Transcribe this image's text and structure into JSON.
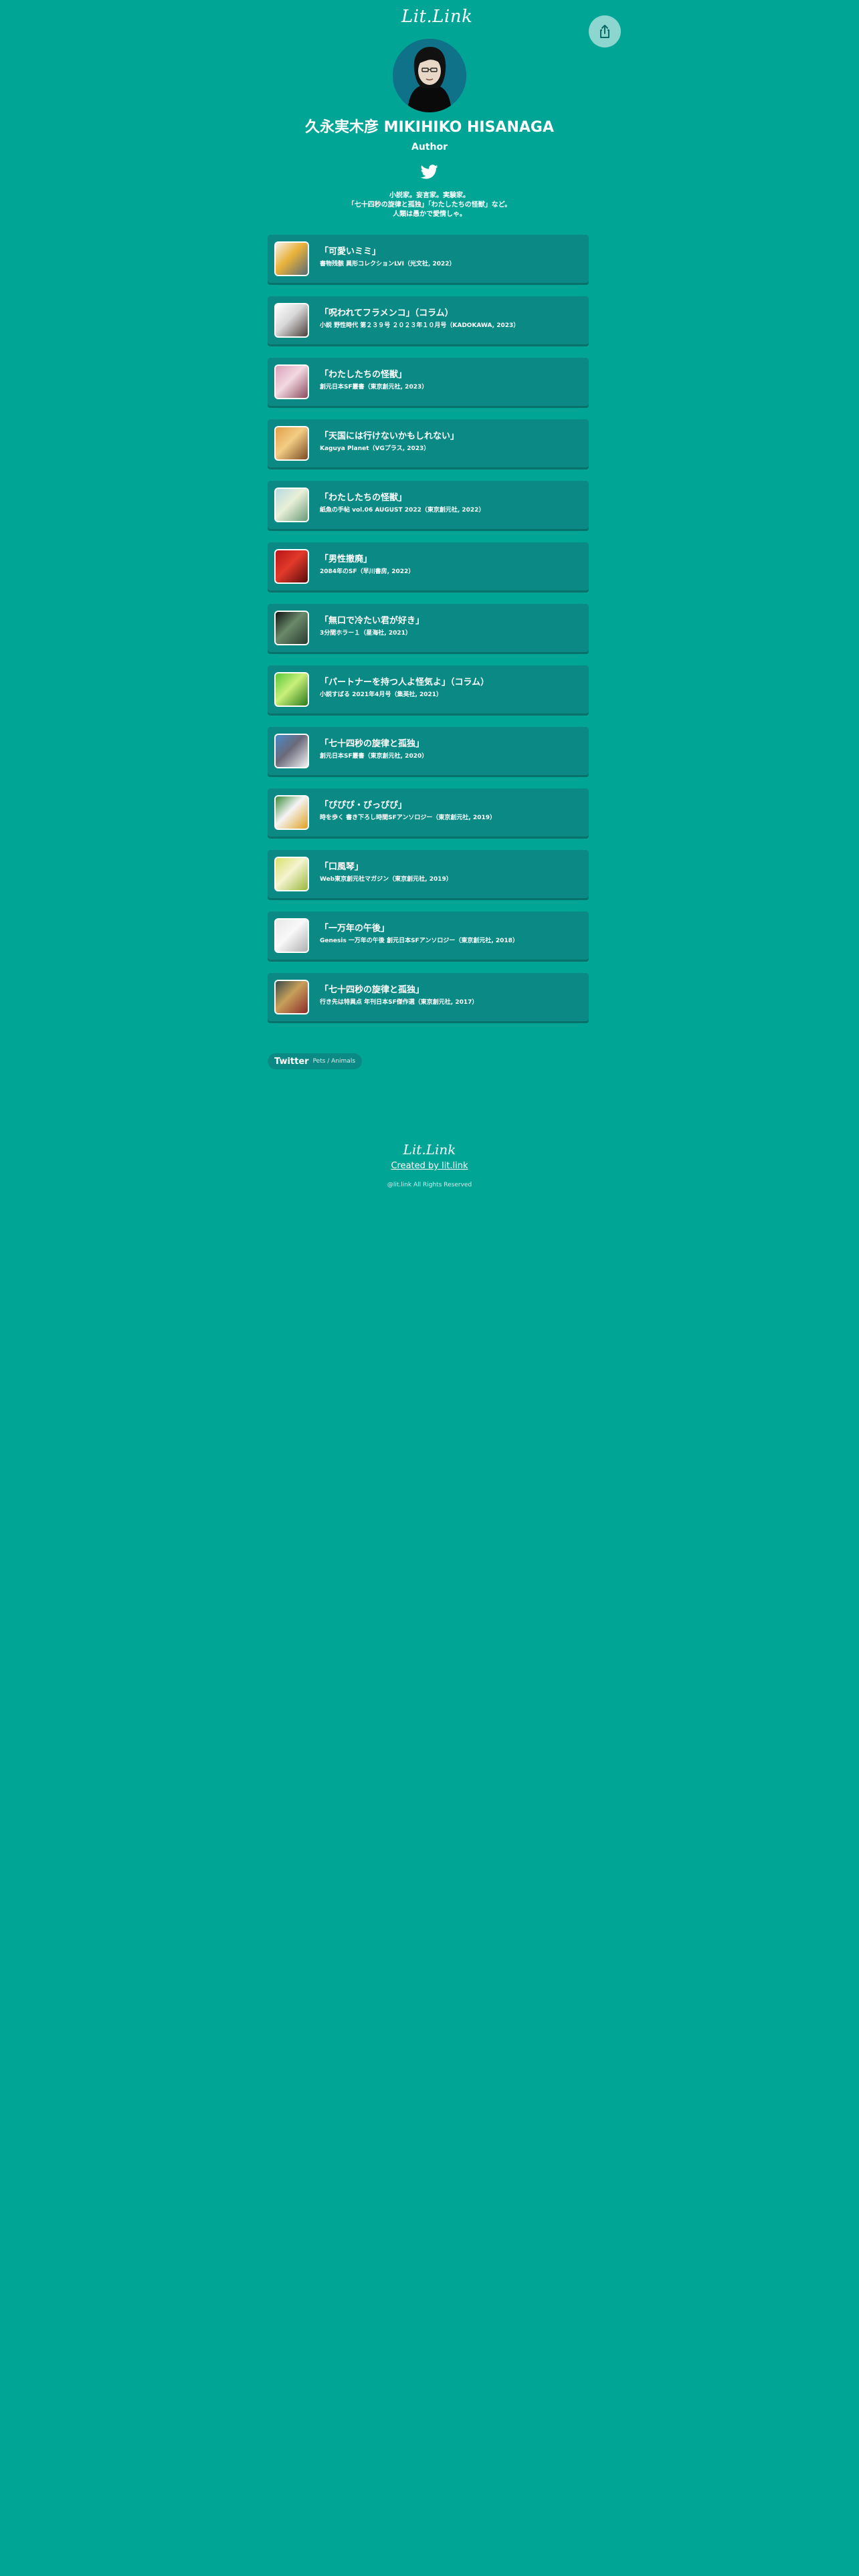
{
  "header": {
    "logo": "Lit.Link",
    "share_icon": "share-icon"
  },
  "profile": {
    "name": "久永実木彦 MIKIHIKO HISANAGA",
    "role": "Author",
    "social_icon": "twitter-icon",
    "bio": [
      "小説家。妄言家。実験家。",
      "「七十四秒の旋律と孤独」「わたしたちの怪獣」など。",
      "人類は愚かで愛情しゃ。"
    ]
  },
  "links": [
    {
      "title": "「可愛いミミ」",
      "sub": "書物残骸 異形コレクションLVI（光文社, 2022）",
      "colors": [
        "#f4f0ea",
        "#5a6a78",
        "#e8b23a"
      ]
    },
    {
      "title": "「呪われてフラメンコ」（コラム）",
      "sub": "小説 野性時代 第２３９号 ２０２３年１０月号（KADOKAWA, 2023）",
      "colors": [
        "#ffffff",
        "#4b3f3a",
        "#d8d8d8"
      ]
    },
    {
      "title": "「わたしたちの怪獣」",
      "sub": "創元日本SF叢書（東京創元社, 2023）",
      "colors": [
        "#d9a0b8",
        "#8a4a5c",
        "#f3d9e2"
      ]
    },
    {
      "title": "「天国には行けないかもしれない」",
      "sub": "Kaguya Planet（VGプラス, 2023）",
      "colors": [
        "#e0a04a",
        "#7a4a22",
        "#f3cc84"
      ]
    },
    {
      "title": "「わたしたちの怪獣」",
      "sub": "紙魚の手帖 vol.06 AUGUST 2022（東京創元社, 2022）",
      "colors": [
        "#b8d8e0",
        "#6a9a78",
        "#e8f0d8"
      ]
    },
    {
      "title": "「男性撤廃」",
      "sub": "2084年のSF（早川書房, 2022）",
      "colors": [
        "#b8141a",
        "#5a0a0c",
        "#e23a2a"
      ]
    },
    {
      "title": "「無口で冷たい君が好き」",
      "sub": "3分間ホラー１（星海社, 2021）",
      "colors": [
        "#101414",
        "#2a3a30",
        "#6a8a6a"
      ]
    },
    {
      "title": "「パートナーを持つ人よ怪気よ」（コラム）",
      "sub": "小説すばる 2021年4月号（集英社, 2021）",
      "colors": [
        "#58c83a",
        "#2a7a1a",
        "#c8f07a"
      ]
    },
    {
      "title": "「七十四秒の旋律と孤独」",
      "sub": "創元日本SF叢書（東京創元社, 2020）",
      "colors": [
        "#4a8ac8",
        "#f2f4f6",
        "#6a6a7a"
      ]
    },
    {
      "title": "「ぴぴぴ・ぴっぴぴ」",
      "sub": "時を歩く 書き下ろし時間SFアンソロジー（東京創元社, 2019）",
      "colors": [
        "#3a8a3a",
        "#e0a020",
        "#f4f4f4"
      ]
    },
    {
      "title": "「口風琴」",
      "sub": "Web東京創元社マガジン（東京創元社, 2019）",
      "colors": [
        "#d8e06a",
        "#9ab83a",
        "#f4f4d0"
      ]
    },
    {
      "title": "「一万年の午後」",
      "sub": "Genesis 一万年の午後 創元日本SFアンソロジー（東京創元社, 2018）",
      "colors": [
        "#e8e8e8",
        "#b0b0b0",
        "#f8f8f8"
      ]
    },
    {
      "title": "「七十四秒の旋律と孤独」",
      "sub": "行き先は特異点 年刊日本SF傑作選（東京創元社, 2017）",
      "colors": [
        "#3a4a4a",
        "#8a2a2a",
        "#c8a05a"
      ]
    }
  ],
  "tag": {
    "label": "Twitter",
    "sub": "Pets / Animals"
  },
  "footer": {
    "logo": "Lit.Link",
    "link": "Created by lit.link",
    "copyright": "@lit.link All Rights Reserved"
  }
}
